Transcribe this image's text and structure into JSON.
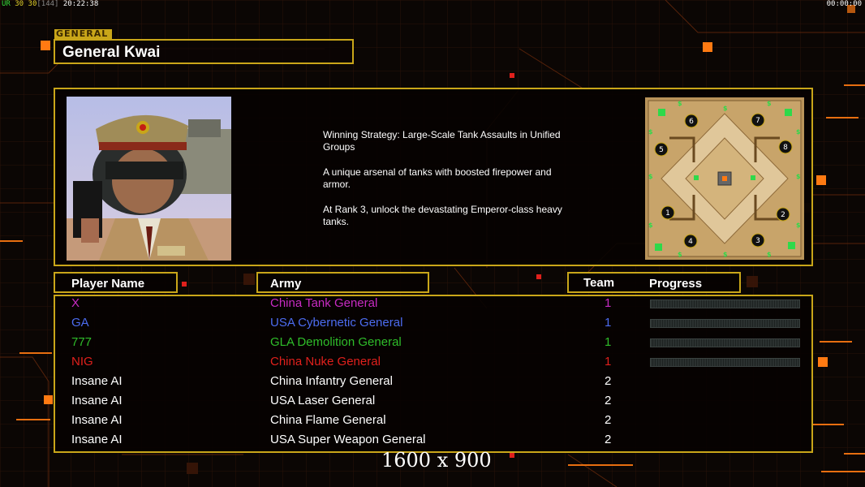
{
  "hud": {
    "left_prefix": "UR",
    "left_a": "30",
    "left_b": "30",
    "left_bracket": "[144]",
    "left_time": "20:22:38",
    "right_time": "00:00:00"
  },
  "general": {
    "tab_label": "GENERAL",
    "name": "General Kwai",
    "strategy": [
      "Winning Strategy: Large-Scale Tank Assaults in Unified Groups",
      "A unique arsenal of tanks with boosted firepower and armor.",
      "At Rank 3, unlock the devastating Emperor-class heavy tanks."
    ]
  },
  "minimap": {
    "spawn_labels": [
      "1",
      "2",
      "3",
      "4",
      "5",
      "6",
      "7",
      "8"
    ]
  },
  "table": {
    "headers": {
      "player": "Player Name",
      "army": "Army",
      "team": "Team",
      "progress": "Progress"
    },
    "rows": [
      {
        "name": "X",
        "army": "China Tank General",
        "team": "1",
        "color": "#c72bc2",
        "progress": true
      },
      {
        "name": "GA",
        "army": "USA Cybernetic General",
        "team": "1",
        "color": "#4c6cf0",
        "progress": true
      },
      {
        "name": "777",
        "army": "GLA Demolition General",
        "team": "1",
        "color": "#2fbd2a",
        "progress": true
      },
      {
        "name": "NIG",
        "army": "China Nuke General",
        "team": "1",
        "color": "#e0201c",
        "progress": true
      },
      {
        "name": "Insane AI",
        "army": "China Infantry General",
        "team": "2",
        "color": "#ffffff",
        "progress": false
      },
      {
        "name": "Insane AI",
        "army": "USA Laser General",
        "team": "2",
        "color": "#ffffff",
        "progress": false
      },
      {
        "name": "Insane AI",
        "army": "China Flame General",
        "team": "2",
        "color": "#ffffff",
        "progress": false
      },
      {
        "name": "Insane AI",
        "army": "USA Super Weapon General",
        "team": "2",
        "color": "#ffffff",
        "progress": false
      }
    ]
  },
  "resolution_label": "1600 x 900",
  "colors": {
    "accent": "#c9a619",
    "orange": "#ff7a12"
  }
}
